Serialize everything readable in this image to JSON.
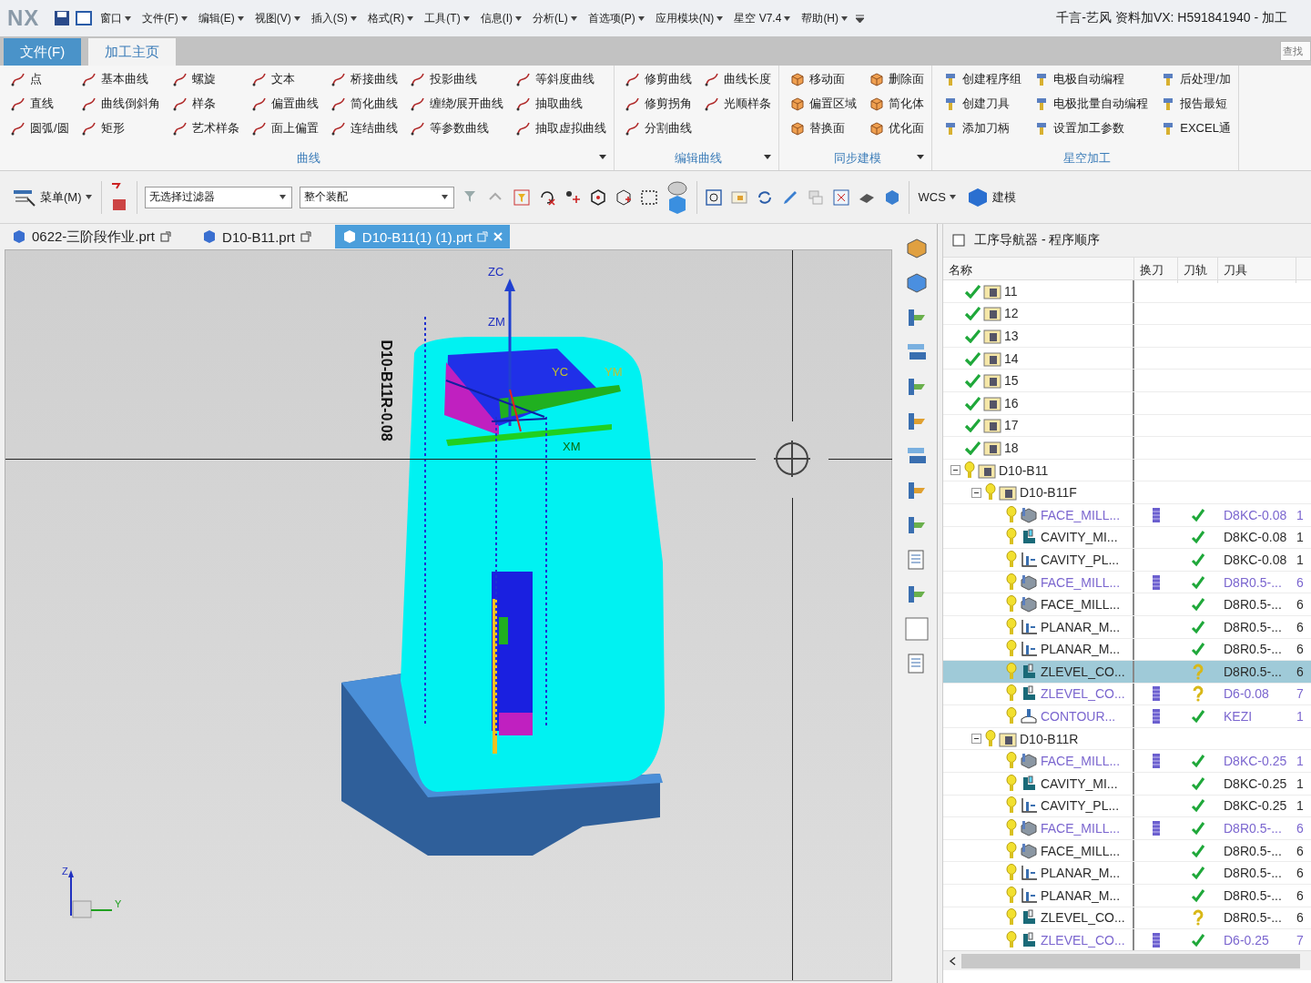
{
  "app": {
    "logo": "NX",
    "title": "千言-艺风 资料加VX: H591841940 - 加工"
  },
  "menus": [
    "窗口",
    "文件(F)",
    "编辑(E)",
    "视图(V)",
    "插入(S)",
    "格式(R)",
    "工具(T)",
    "信息(I)",
    "分析(L)",
    "首选项(P)",
    "应用模块(N)",
    "星空 V7.4",
    "帮助(H)"
  ],
  "ribbon_tabs": [
    {
      "label": "文件(F)",
      "kind": "file",
      "selected": false
    },
    {
      "label": "加工主页",
      "kind": "tab",
      "selected": true
    }
  ],
  "search": {
    "placeholder": "查找"
  },
  "ribbon_groups": [
    {
      "label": "曲线",
      "kind": "curve",
      "more": true,
      "columns": [
        [
          "点",
          "直线",
          "圆弧/圆"
        ],
        [
          "基本曲线",
          "曲线倒斜角",
          "矩形"
        ],
        [
          "螺旋",
          "样条",
          "艺术样条"
        ],
        [
          "文本",
          "偏置曲线",
          "面上偏置"
        ],
        [
          "桥接曲线",
          "简化曲线",
          "连结曲线"
        ],
        [
          "投影曲线",
          "缠绕/展开曲线",
          "等参数曲线"
        ],
        [
          "等斜度曲线",
          "抽取曲线",
          "抽取虚拟曲线"
        ]
      ]
    },
    {
      "label": "编辑曲线",
      "kind": "curve",
      "more": true,
      "columns": [
        [
          "修剪曲线",
          "修剪拐角",
          "分割曲线"
        ],
        [
          "曲线长度",
          "光顺样条"
        ]
      ]
    },
    {
      "label": "同步建模",
      "kind": "sync",
      "more": true,
      "columns": [
        [
          "移动面",
          "偏置区域",
          "替换面"
        ],
        [
          "删除面",
          "简化体",
          "优化面"
        ]
      ]
    },
    {
      "label": "星空加工",
      "kind": "cam",
      "more": false,
      "columns": [
        [
          "创建程序组",
          "创建刀具",
          "添加刀柄"
        ],
        [
          "电极自动编程",
          "电极批量自动编程",
          "设置加工参数"
        ],
        [
          "后处理/加",
          "报告最短",
          "EXCEL通"
        ]
      ]
    }
  ],
  "toolbar": {
    "menu_button": "菜单(M)",
    "filters": [
      "无选择过滤器",
      "整个装配"
    ],
    "wcs": "WCS",
    "modeling": "建模"
  },
  "doc_tabs": [
    {
      "label": "0622-三阶段作业.prt",
      "selected": false
    },
    {
      "label": "D10-B11.prt",
      "selected": false
    },
    {
      "label": "D10-B11(1) (1).prt",
      "selected": true
    }
  ],
  "viewport": {
    "part_label": "D10-B11R-0.08",
    "axis_labels": [
      "ZC",
      "ZM",
      "YC",
      "YM",
      "XM"
    ],
    "triad_labels": [
      "Z",
      "Y"
    ]
  },
  "navigator": {
    "title": "工序导航器 - 程序顺序",
    "columns": [
      "名称",
      "换刀",
      "刀轨",
      "刀具"
    ],
    "rows": [
      {
        "name": "11",
        "complete": true,
        "selected": false
      },
      {
        "name": "12",
        "complete": true,
        "selected": false
      },
      {
        "name": "13",
        "complete": true,
        "selected": false
      },
      {
        "name": "14",
        "complete": true,
        "selected": false
      },
      {
        "name": "15",
        "complete": true,
        "selected": false
      },
      {
        "name": "16",
        "complete": true,
        "selected": false
      },
      {
        "name": "17",
        "complete": true,
        "selected": false
      },
      {
        "name": "18",
        "complete": true,
        "selected": false
      },
      {
        "name": "D10-B11",
        "complete": false,
        "expanded": true,
        "selected": false,
        "children": [
          {
            "name": "D10-B11F",
            "complete": false,
            "expanded": true,
            "selected": false,
            "children": [
              {
                "name": "FACE_MILL...",
                "kind": "face",
                "complete": false,
                "modified": true,
                "tool_change": true,
                "path_ok": true,
                "tool": "D8KC-0.08",
                "column_5": "1",
                "selected": false
              },
              {
                "name": "CAVITY_MI...",
                "kind": "cavity",
                "complete": false,
                "modified": false,
                "tool_change": false,
                "path_ok": true,
                "tool": "D8KC-0.08",
                "column_5": "1",
                "selected": false
              },
              {
                "name": "CAVITY_PL...",
                "kind": "planar",
                "complete": false,
                "modified": false,
                "tool_change": false,
                "path_ok": true,
                "tool": "D8KC-0.08",
                "column_5": "1",
                "selected": false
              },
              {
                "name": "FACE_MILL...",
                "kind": "face",
                "complete": false,
                "modified": true,
                "tool_change": true,
                "path_ok": true,
                "tool": "D8R0.5-...",
                "column_5": "6",
                "selected": false
              },
              {
                "name": "FACE_MILL...",
                "kind": "face",
                "complete": false,
                "modified": false,
                "tool_change": false,
                "path_ok": true,
                "tool": "D8R0.5-...",
                "column_5": "6",
                "selected": false
              },
              {
                "name": "PLANAR_M...",
                "kind": "planar",
                "complete": false,
                "modified": false,
                "tool_change": false,
                "path_ok": true,
                "tool": "D8R0.5-...",
                "column_5": "6",
                "selected": false
              },
              {
                "name": "PLANAR_M...",
                "kind": "planar",
                "complete": false,
                "modified": false,
                "tool_change": false,
                "path_ok": true,
                "tool": "D8R0.5-...",
                "column_5": "6",
                "selected": false
              },
              {
                "name": "ZLEVEL_CO...",
                "kind": "zlevel",
                "complete": false,
                "modified": false,
                "tool_change": false,
                "path_ok": false,
                "tool": "D8R0.5-...",
                "column_5": "6",
                "selected": true
              },
              {
                "name": "ZLEVEL_CO...",
                "kind": "zlevel",
                "complete": false,
                "modified": true,
                "tool_change": true,
                "path_ok": false,
                "tool": "D6-0.08",
                "column_5": "7",
                "selected": false
              },
              {
                "name": "CONTOUR...",
                "kind": "contour",
                "complete": false,
                "modified": true,
                "tool_change": true,
                "path_ok": true,
                "tool": "KEZI",
                "column_5": "1",
                "selected": false
              }
            ]
          },
          {
            "name": "D10-B11R",
            "complete": false,
            "expanded": true,
            "selected": false,
            "children": [
              {
                "name": "FACE_MILL...",
                "kind": "face",
                "complete": false,
                "modified": true,
                "tool_change": true,
                "path_ok": true,
                "tool": "D8KC-0.25",
                "column_5": "1",
                "selected": false
              },
              {
                "name": "CAVITY_MI...",
                "kind": "cavity",
                "complete": false,
                "modified": false,
                "tool_change": false,
                "path_ok": true,
                "tool": "D8KC-0.25",
                "column_5": "1",
                "selected": false
              },
              {
                "name": "CAVITY_PL...",
                "kind": "planar",
                "complete": false,
                "modified": false,
                "tool_change": false,
                "path_ok": true,
                "tool": "D8KC-0.25",
                "column_5": "1",
                "selected": false
              },
              {
                "name": "FACE_MILL...",
                "kind": "face",
                "complete": false,
                "modified": true,
                "tool_change": true,
                "path_ok": true,
                "tool": "D8R0.5-...",
                "column_5": "6",
                "selected": false
              },
              {
                "name": "FACE_MILL...",
                "kind": "face",
                "complete": false,
                "modified": false,
                "tool_change": false,
                "path_ok": true,
                "tool": "D8R0.5-...",
                "column_5": "6",
                "selected": false
              },
              {
                "name": "PLANAR_M...",
                "kind": "planar",
                "complete": false,
                "modified": false,
                "tool_change": false,
                "path_ok": true,
                "tool": "D8R0.5-...",
                "column_5": "6",
                "selected": false
              },
              {
                "name": "PLANAR_M...",
                "kind": "planar",
                "complete": false,
                "modified": false,
                "tool_change": false,
                "path_ok": true,
                "tool": "D8R0.5-...",
                "column_5": "6",
                "selected": false
              },
              {
                "name": "ZLEVEL_CO...",
                "kind": "zlevel",
                "complete": false,
                "modified": false,
                "tool_change": false,
                "path_ok": false,
                "tool": "D8R0.5-...",
                "column_5": "6",
                "selected": false
              },
              {
                "name": "ZLEVEL_CO...",
                "kind": "zlevel",
                "complete": false,
                "modified": true,
                "tool_change": true,
                "path_ok": true,
                "tool": "D6-0.25",
                "column_5": "7",
                "selected": false
              }
            ]
          }
        ]
      }
    ]
  }
}
